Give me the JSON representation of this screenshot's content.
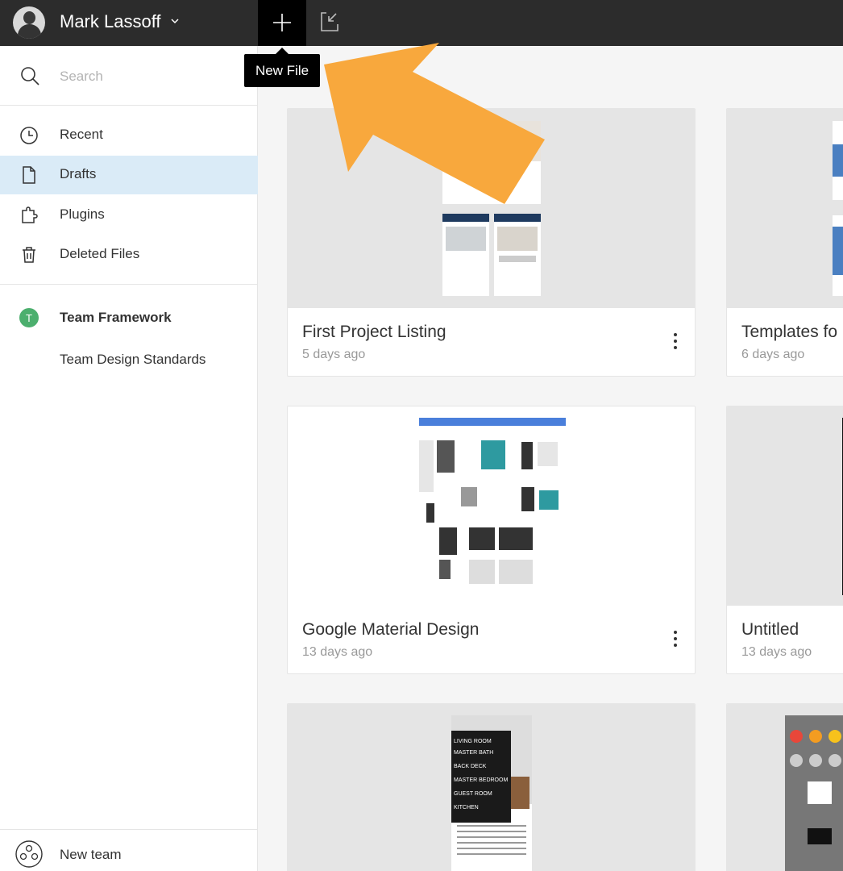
{
  "user": {
    "name": "Mark Lassoff"
  },
  "toolbar": {
    "new_file_tooltip": "New File"
  },
  "sidebar": {
    "search_placeholder": "Search",
    "items": [
      {
        "label": "Recent",
        "icon": "clock-icon"
      },
      {
        "label": "Drafts",
        "icon": "file-icon",
        "active": true
      },
      {
        "label": "Plugins",
        "icon": "puzzle-icon"
      },
      {
        "label": "Deleted Files",
        "icon": "trash-icon"
      }
    ],
    "team": {
      "badge": "T",
      "name": "Team Framework",
      "project": "Team Design Standards"
    },
    "new_team_label": "New team"
  },
  "files": [
    {
      "title": "First Project Listing",
      "date": "5 days ago"
    },
    {
      "title": "Templates fo",
      "date": "6 days ago"
    },
    {
      "title": "Google Material Design",
      "date": "13 days ago"
    },
    {
      "title": "Untitled",
      "date": "13 days ago"
    },
    {
      "title": "",
      "date": "",
      "menu_items": [
        "LIVING ROOM",
        "MASTER BATH",
        "BACK DECK",
        "MASTER BEDROOM",
        "GUEST ROOM",
        "KITCHEN"
      ]
    },
    {
      "title": "",
      "date": ""
    }
  ],
  "colors": {
    "accent_arrow": "#f8a83d",
    "active_bg": "#daebf7",
    "team_badge": "#4caf6e"
  }
}
